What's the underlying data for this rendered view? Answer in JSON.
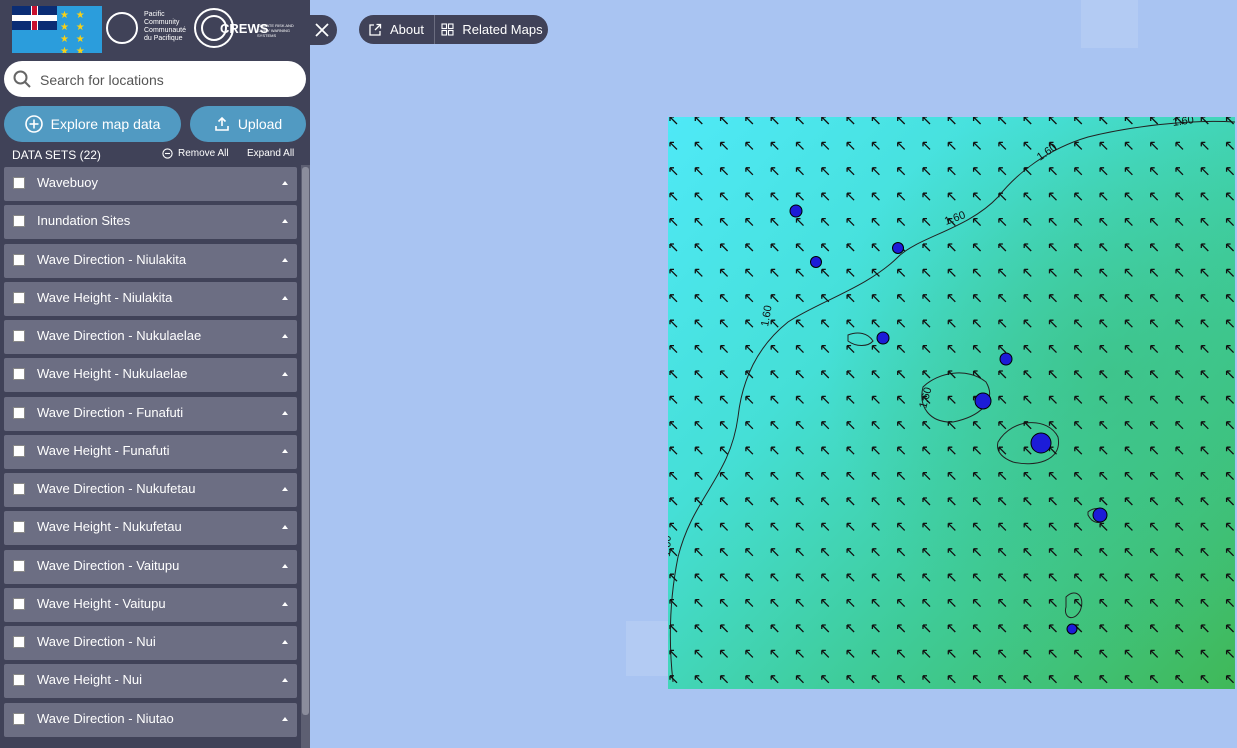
{
  "header": {
    "logos": [
      {
        "name": "Tuvalu flag"
      },
      {
        "name": "Pacific Community",
        "lines": [
          "Pacific",
          "Community",
          "Communauté",
          "du Pacifique"
        ]
      },
      {
        "name": "CREWS",
        "text": "CREWS",
        "tagline": "CLIMATE RISK AND EARLY WARNING SYSTEMS"
      }
    ]
  },
  "search": {
    "placeholder": "Search for locations"
  },
  "buttons": {
    "explore": "Explore map data",
    "upload": "Upload"
  },
  "datasets": {
    "title": "DATA SETS (22)",
    "remove_all": "Remove All",
    "expand_all": "Expand All",
    "items": [
      {
        "label": "Wavebuoy",
        "checked": false
      },
      {
        "label": "Inundation Sites",
        "checked": false
      },
      {
        "label": "Wave Direction - Niulakita",
        "checked": false
      },
      {
        "label": "Wave Height - Niulakita",
        "checked": false
      },
      {
        "label": "Wave Direction - Nukulaelae",
        "checked": false
      },
      {
        "label": "Wave Height - Nukulaelae",
        "checked": false
      },
      {
        "label": "Wave Direction - Funafuti",
        "checked": false
      },
      {
        "label": "Wave Height - Funafuti",
        "checked": false
      },
      {
        "label": "Wave Direction - Nukufetau",
        "checked": false
      },
      {
        "label": "Wave Height - Nukufetau",
        "checked": false
      },
      {
        "label": "Wave Direction - Vaitupu",
        "checked": false
      },
      {
        "label": "Wave Height - Vaitupu",
        "checked": false
      },
      {
        "label": "Wave Direction - Nui",
        "checked": false
      },
      {
        "label": "Wave Height - Nui",
        "checked": false
      },
      {
        "label": "Wave Direction - Niutao",
        "checked": false
      }
    ]
  },
  "map_controls": {
    "about": "About",
    "related_maps": "Related Maps"
  },
  "map": {
    "contour_labels": [
      "1.60",
      "1.60",
      "1.60",
      "1.60",
      "1.60",
      "1.60"
    ],
    "colors": {
      "ocean_background": "#a9c4f2",
      "wave_low": "#48e6f7",
      "wave_high": "#3dba63",
      "markers": "#1c1cd8",
      "sidebar": "#404258",
      "button": "#519ac2"
    }
  }
}
